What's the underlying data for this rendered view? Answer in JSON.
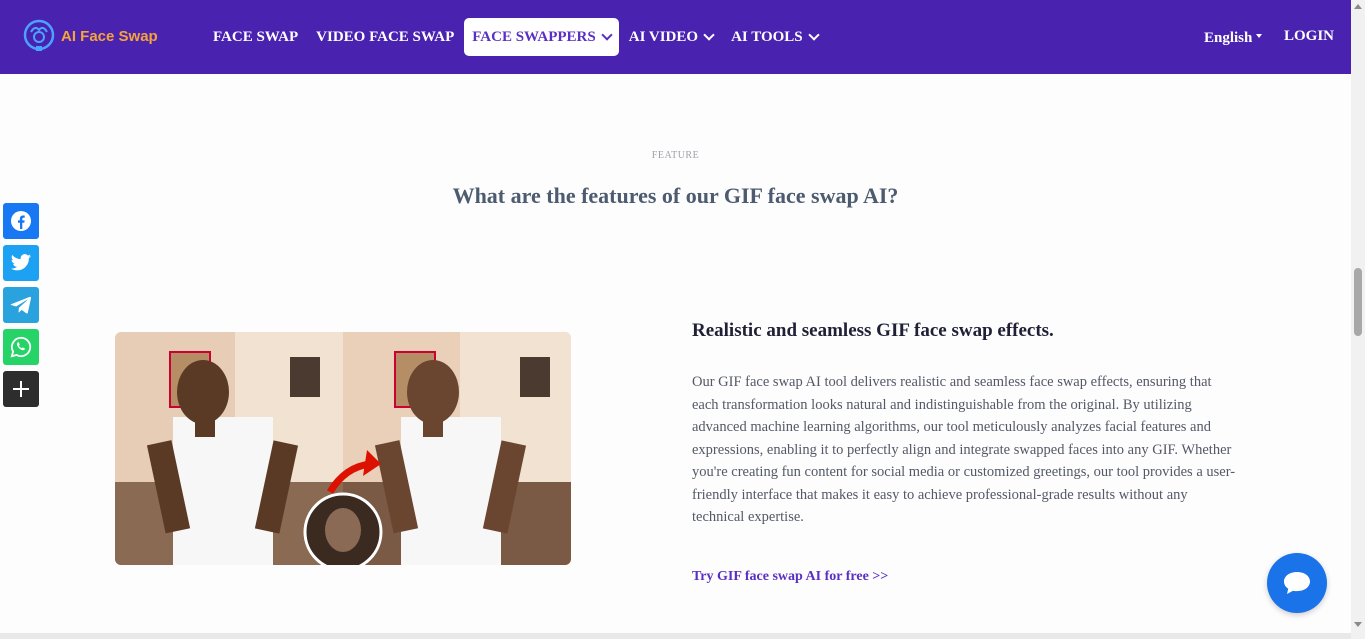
{
  "brand": {
    "name": "AI Face Swap",
    "accent": "#4a22b0",
    "logo_color": "#f5a33b"
  },
  "nav": {
    "items": [
      {
        "label": "FACE SWAP",
        "dropdown": false
      },
      {
        "label": "VIDEO FACE SWAP",
        "dropdown": false
      },
      {
        "label": "FACE SWAPPERS",
        "dropdown": true,
        "active": true
      },
      {
        "label": "AI VIDEO",
        "dropdown": true
      },
      {
        "label": "AI TOOLS",
        "dropdown": true
      }
    ],
    "language": "English",
    "login": "LOGIN"
  },
  "section": {
    "eyebrow": "FEATURE",
    "headline": "What are the features of our GIF face swap AI?"
  },
  "social": [
    "facebook-icon",
    "twitter-icon",
    "telegram-icon",
    "whatsapp-icon",
    "plus-icon"
  ],
  "feature": {
    "title": "Realistic and seamless GIF face swap effects.",
    "body": "Our GIF face swap AI tool delivers realistic and seamless face swap effects, ensuring that each transformation looks natural and indistinguishable from the original. By utilizing advanced machine learning algorithms, our tool meticulously analyzes facial features and expressions, enabling it to perfectly align and integrate swapped faces into any GIF. Whether you're creating fun content for social media or customized greetings, our tool provides a user-friendly interface that makes it easy to achieve professional-grade results without any technical expertise.",
    "link": "Try GIF face swap AI for free >>"
  },
  "chat": {
    "icon": "chat-icon",
    "color": "#1a73e8"
  }
}
